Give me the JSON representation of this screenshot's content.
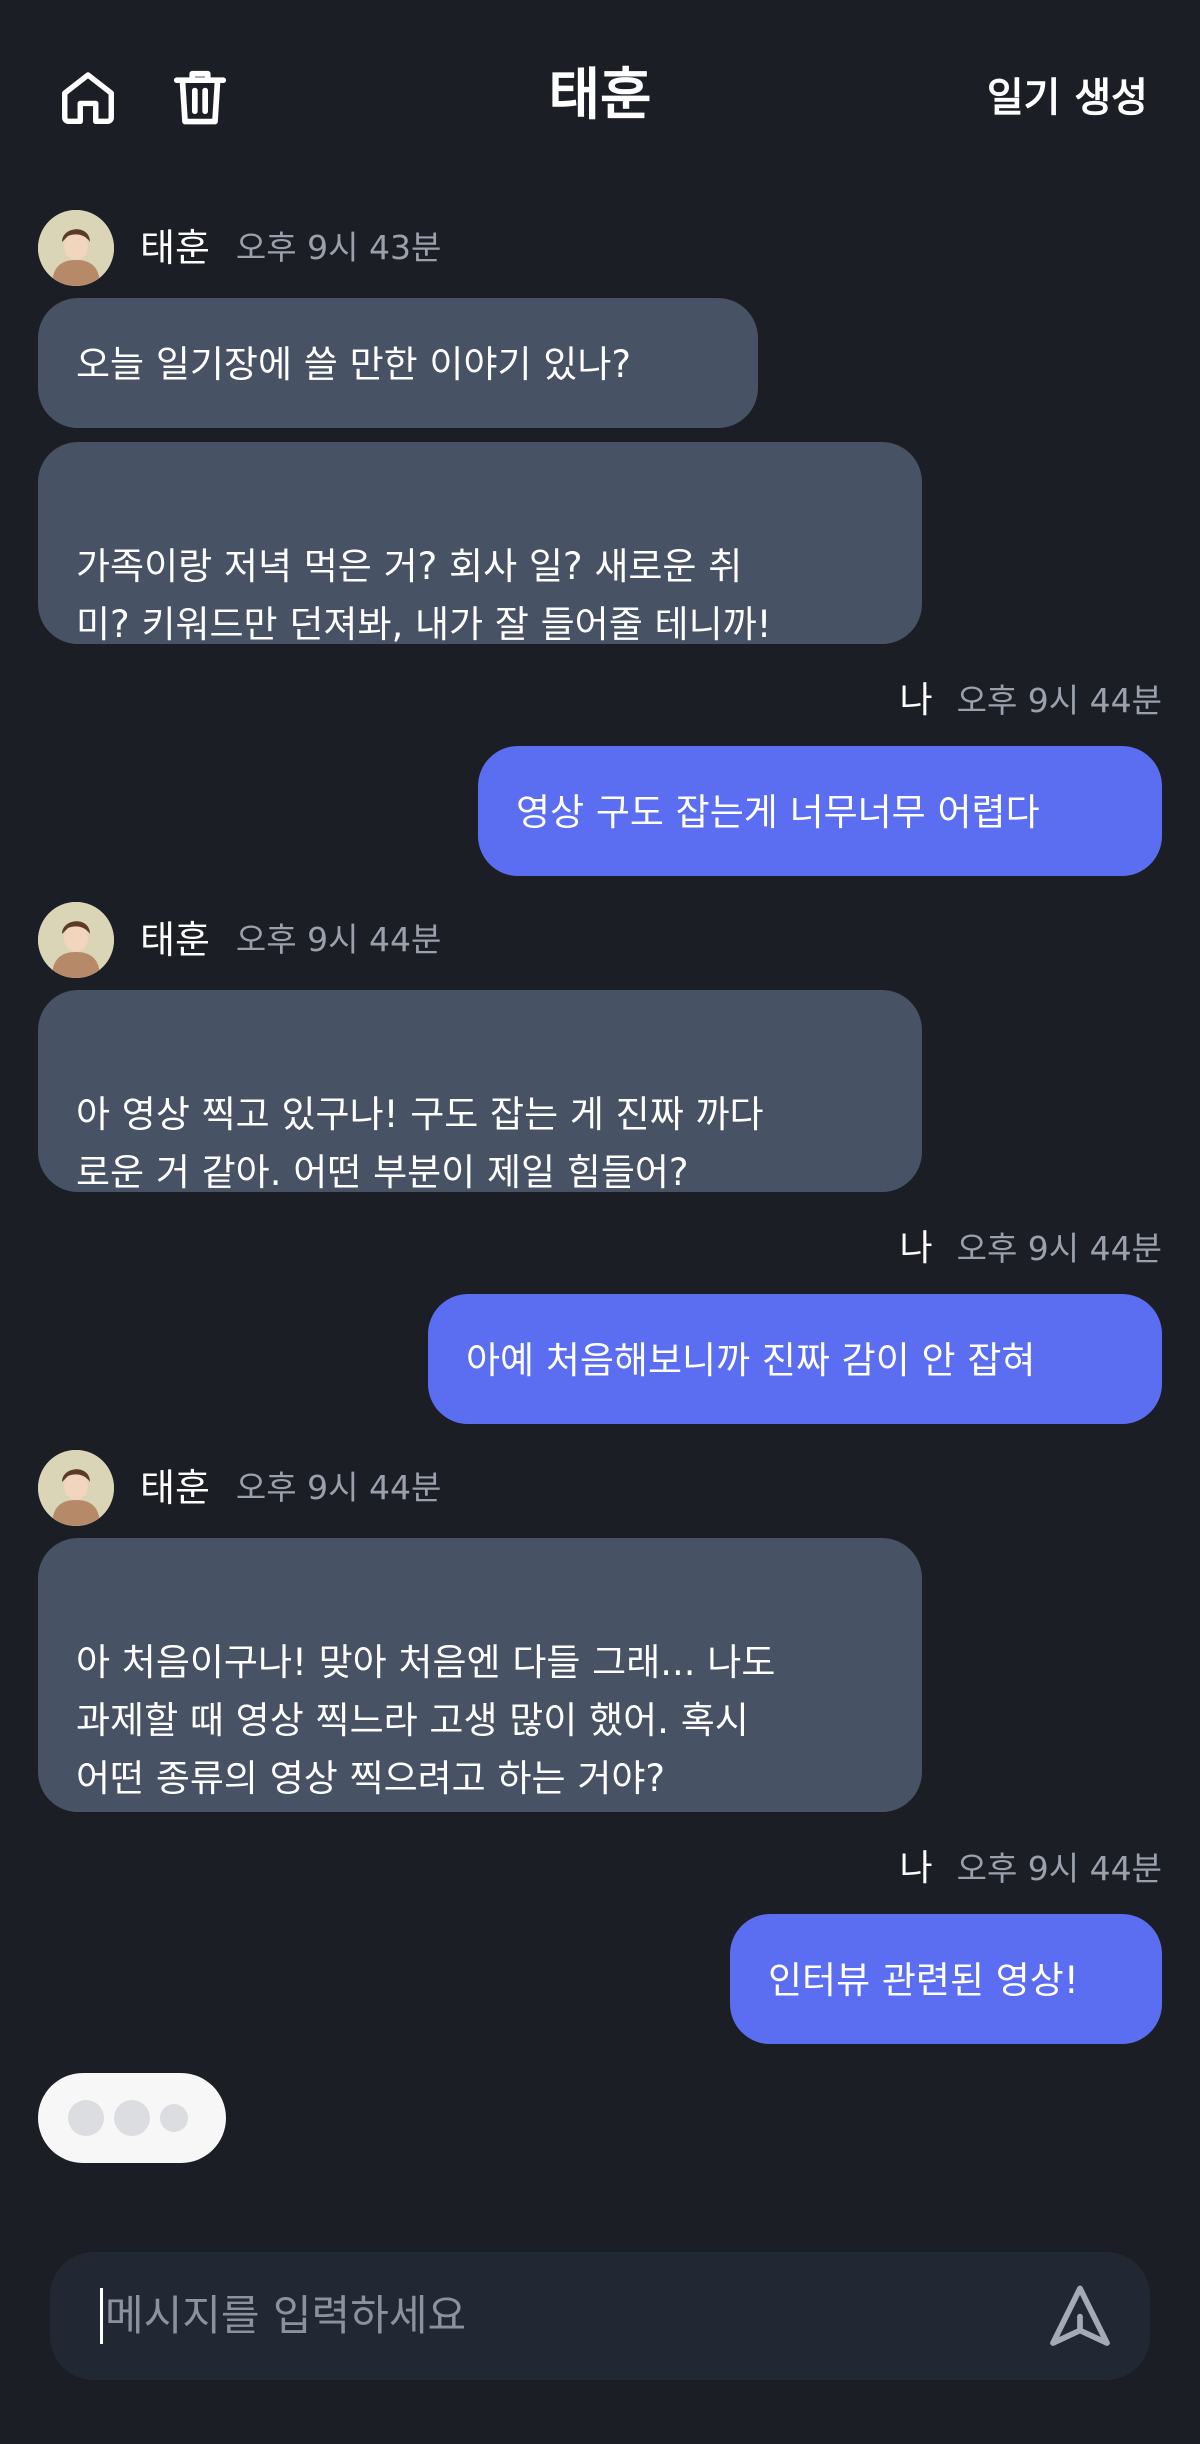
{
  "header": {
    "title": "태훈",
    "diary_button": "일기 생성"
  },
  "messages": [
    {
      "from": "bot",
      "name": "태훈",
      "time": "오후 9시 43분",
      "bubbles": [
        "오늘 일기장에 쓸 만한 이야기 있나?",
        "가족이랑 저녁 먹은 거? 회사 일? 새로운 취\n미? 키워드만 던져봐, 내가 잘 들어줄 테니까!"
      ]
    },
    {
      "from": "me",
      "name": "나",
      "time": "오후 9시 44분",
      "bubbles": [
        "영상 구도 잡는게 너무너무 어렵다"
      ]
    },
    {
      "from": "bot",
      "name": "태훈",
      "time": "오후 9시 44분",
      "bubbles": [
        "아 영상 찍고 있구나! 구도 잡는 게 진짜 까다\n로운 거 같아. 어떤 부분이 제일 힘들어?"
      ]
    },
    {
      "from": "me",
      "name": "나",
      "time": "오후 9시 44분",
      "bubbles": [
        "아예 처음해보니까 진짜 감이 안 잡혀"
      ]
    },
    {
      "from": "bot",
      "name": "태훈",
      "time": "오후 9시 44분",
      "bubbles": [
        "아 처음이구나! 맞아 처음엔 다들 그래... 나도\n과제할 때 영상 찍느라 고생 많이 했어. 혹시\n어떤 종류의 영상 찍으려고 하는 거야?"
      ]
    },
    {
      "from": "me",
      "name": "나",
      "time": "오후 9시 44분",
      "bubbles": [
        "인터뷰 관련된 영상!"
      ]
    }
  ],
  "input": {
    "placeholder": "메시지를 입력하세요"
  },
  "colors": {
    "background": "#1b1e24",
    "bot_bubble": "#475264",
    "my_bubble": "#5b6ef2",
    "timestamp": "#9aa1ad"
  },
  "icons": {
    "home": "home-icon",
    "trash": "trash-icon",
    "send": "send-icon"
  }
}
